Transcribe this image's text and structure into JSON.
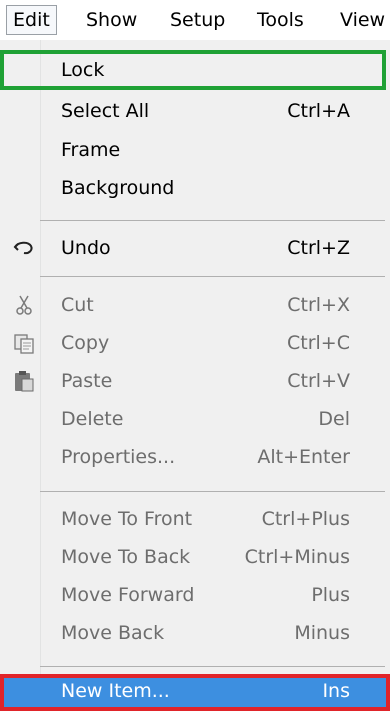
{
  "menubar": {
    "items": [
      {
        "label": "Edit"
      },
      {
        "label": "Show"
      },
      {
        "label": "Setup"
      },
      {
        "label": "Tools"
      },
      {
        "label": "View"
      }
    ]
  },
  "menu": {
    "items": [
      {
        "label": "Lock",
        "shortcut": "",
        "enabled": true
      },
      {
        "label": "Select All",
        "shortcut": "Ctrl+A",
        "enabled": true
      },
      {
        "label": "Frame",
        "shortcut": "",
        "enabled": true
      },
      {
        "label": "Background",
        "shortcut": "",
        "enabled": true
      },
      {
        "label": "Undo",
        "shortcut": "Ctrl+Z",
        "enabled": true,
        "icon": "undo-icon"
      },
      {
        "label": "Cut",
        "shortcut": "Ctrl+X",
        "enabled": false,
        "icon": "scissors-icon"
      },
      {
        "label": "Copy",
        "shortcut": "Ctrl+C",
        "enabled": false,
        "icon": "copy-icon"
      },
      {
        "label": "Paste",
        "shortcut": "Ctrl+V",
        "enabled": false,
        "icon": "paste-icon"
      },
      {
        "label": "Delete",
        "shortcut": "Del",
        "enabled": false
      },
      {
        "label": "Properties...",
        "shortcut": "Alt+Enter",
        "enabled": false
      },
      {
        "label": "Move To Front",
        "shortcut": "Ctrl+Plus",
        "enabled": false
      },
      {
        "label": "Move To Back",
        "shortcut": "Ctrl+Minus",
        "enabled": false
      },
      {
        "label": "Move Forward",
        "shortcut": "Plus",
        "enabled": false
      },
      {
        "label": "Move Back",
        "shortcut": "Minus",
        "enabled": false
      },
      {
        "label": "New Item...",
        "shortcut": "Ins",
        "enabled": true,
        "highlighted": true
      }
    ]
  },
  "colors": {
    "highlight_green": "#1fa135",
    "highlight_red": "#e0242a",
    "selected_bg": "#3d8fe0",
    "disabled_text": "#6d6d6d"
  }
}
